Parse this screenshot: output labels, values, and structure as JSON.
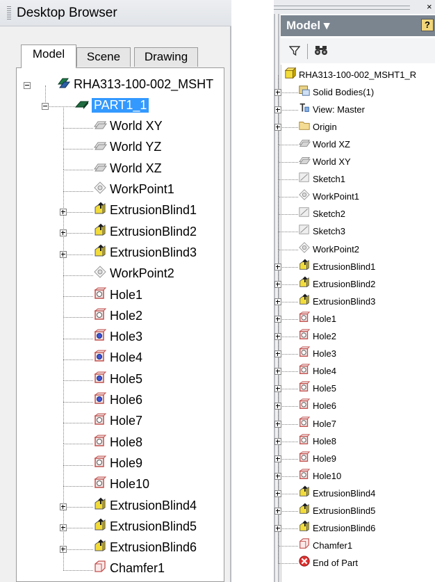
{
  "left_panel": {
    "title": "Desktop Browser",
    "tabs": [
      {
        "label": "Model",
        "active": true
      },
      {
        "label": "Scene",
        "active": false
      },
      {
        "label": "Drawing",
        "active": false
      }
    ],
    "tree": [
      {
        "label": "RHA313-100-002_MSHT",
        "icon": "assembly-icon",
        "level": 0,
        "expander": "minus"
      },
      {
        "label": "PART1_1",
        "icon": "part-icon",
        "level": 1,
        "expander": "minus",
        "selected": true
      },
      {
        "label": "World XY",
        "icon": "work-plane-icon",
        "level": 2
      },
      {
        "label": "World YZ",
        "icon": "work-plane-icon",
        "level": 2
      },
      {
        "label": "World XZ",
        "icon": "work-plane-icon",
        "level": 2
      },
      {
        "label": "WorkPoint1",
        "icon": "work-point-icon",
        "level": 2
      },
      {
        "label": "ExtrusionBlind1",
        "icon": "extrusion-icon",
        "level": 2,
        "expander": "plus"
      },
      {
        "label": "ExtrusionBlind2",
        "icon": "extrusion-icon",
        "level": 2,
        "expander": "plus"
      },
      {
        "label": "ExtrusionBlind3",
        "icon": "extrusion-icon",
        "level": 2,
        "expander": "plus"
      },
      {
        "label": "WorkPoint2",
        "icon": "work-point-icon",
        "level": 2
      },
      {
        "label": "Hole1",
        "icon": "hole-icon",
        "level": 2
      },
      {
        "label": "Hole2",
        "icon": "hole-icon",
        "level": 2
      },
      {
        "label": "Hole3",
        "icon": "hole-blue-icon",
        "level": 2
      },
      {
        "label": "Hole4",
        "icon": "hole-blue-icon",
        "level": 2
      },
      {
        "label": "Hole5",
        "icon": "hole-blue-icon",
        "level": 2
      },
      {
        "label": "Hole6",
        "icon": "hole-blue-icon",
        "level": 2
      },
      {
        "label": "Hole7",
        "icon": "hole-icon",
        "level": 2
      },
      {
        "label": "Hole8",
        "icon": "hole-icon",
        "level": 2
      },
      {
        "label": "Hole9",
        "icon": "hole-icon",
        "level": 2
      },
      {
        "label": "Hole10",
        "icon": "hole-icon",
        "level": 2
      },
      {
        "label": "ExtrusionBlind4",
        "icon": "extrusion-icon",
        "level": 2,
        "expander": "plus"
      },
      {
        "label": "ExtrusionBlind5",
        "icon": "extrusion-icon",
        "level": 2,
        "expander": "plus"
      },
      {
        "label": "ExtrusionBlind6",
        "icon": "extrusion-icon",
        "level": 2,
        "expander": "plus"
      },
      {
        "label": "Chamfer1",
        "icon": "chamfer-icon",
        "level": 2
      }
    ]
  },
  "right_panel": {
    "header": "Model ▾",
    "help_glyph": "?",
    "close_glyph": "×",
    "toolbar": {
      "filter_icon": "filter-icon",
      "find_icon": "binoculars-icon"
    },
    "tree": [
      {
        "label": "RHA313-100-002_MSHT1_R",
        "icon": "part-yellow-icon",
        "level": 0
      },
      {
        "label": "Solid Bodies(1)",
        "icon": "solid-bodies-icon",
        "level": 1,
        "expander": "plus"
      },
      {
        "label": "View: Master",
        "icon": "view-icon",
        "level": 1,
        "expander": "plus"
      },
      {
        "label": "Origin",
        "icon": "folder-icon",
        "level": 1,
        "expander": "plus"
      },
      {
        "label": "World XZ",
        "icon": "work-plane-icon",
        "level": 1
      },
      {
        "label": "World XY",
        "icon": "work-plane-icon",
        "level": 1
      },
      {
        "label": "Sketch1",
        "icon": "sketch-icon",
        "level": 1
      },
      {
        "label": "WorkPoint1",
        "icon": "work-point-icon",
        "level": 1
      },
      {
        "label": "Sketch2",
        "icon": "sketch-icon",
        "level": 1
      },
      {
        "label": "Sketch3",
        "icon": "sketch-icon",
        "level": 1
      },
      {
        "label": "WorkPoint2",
        "icon": "work-point-icon",
        "level": 1
      },
      {
        "label": "ExtrusionBlind1",
        "icon": "extrusion-icon",
        "level": 1,
        "expander": "plus"
      },
      {
        "label": "ExtrusionBlind2",
        "icon": "extrusion-icon",
        "level": 1,
        "expander": "plus"
      },
      {
        "label": "ExtrusionBlind3",
        "icon": "extrusion-icon",
        "level": 1,
        "expander": "plus"
      },
      {
        "label": "Hole1",
        "icon": "hole-icon",
        "level": 1,
        "expander": "plus"
      },
      {
        "label": "Hole2",
        "icon": "hole-icon",
        "level": 1,
        "expander": "plus"
      },
      {
        "label": "Hole3",
        "icon": "hole-icon",
        "level": 1,
        "expander": "plus"
      },
      {
        "label": "Hole4",
        "icon": "hole-icon",
        "level": 1,
        "expander": "plus"
      },
      {
        "label": "Hole5",
        "icon": "hole-icon",
        "level": 1,
        "expander": "plus"
      },
      {
        "label": "Hole6",
        "icon": "hole-icon",
        "level": 1,
        "expander": "plus"
      },
      {
        "label": "Hole7",
        "icon": "hole-icon",
        "level": 1,
        "expander": "plus"
      },
      {
        "label": "Hole8",
        "icon": "hole-icon",
        "level": 1,
        "expander": "plus"
      },
      {
        "label": "Hole9",
        "icon": "hole-icon",
        "level": 1,
        "expander": "plus"
      },
      {
        "label": "Hole10",
        "icon": "hole-icon",
        "level": 1,
        "expander": "plus"
      },
      {
        "label": "ExtrusionBlind4",
        "icon": "extrusion-icon",
        "level": 1,
        "expander": "plus"
      },
      {
        "label": "ExtrusionBlind5",
        "icon": "extrusion-icon",
        "level": 1,
        "expander": "plus"
      },
      {
        "label": "ExtrusionBlind6",
        "icon": "extrusion-icon",
        "level": 1,
        "expander": "plus"
      },
      {
        "label": "Chamfer1",
        "icon": "chamfer-icon",
        "level": 1
      },
      {
        "label": "End of Part",
        "icon": "end-of-part-icon",
        "level": 1
      }
    ]
  },
  "colors": {
    "selection": "#3399ff",
    "header": "#7b8590",
    "extrusion_yellow": "#f2dc3a",
    "hole_red": "#c0504d",
    "end_of_part": "#e03030"
  }
}
